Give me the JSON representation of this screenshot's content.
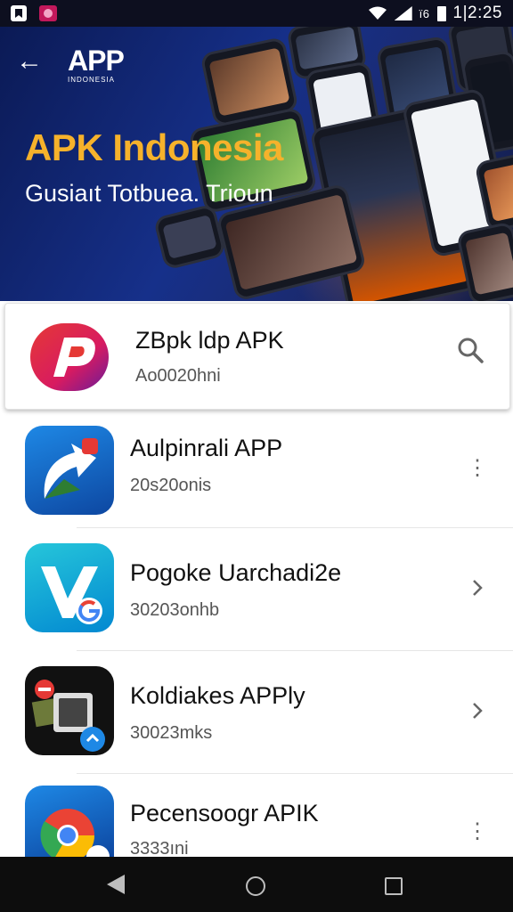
{
  "status_bar": {
    "signal_text": "ï6",
    "time": "1|2:25"
  },
  "banner": {
    "logo_text": "APP",
    "logo_subtext": "INDONESIA",
    "title": "APK Indonesia",
    "subtitle": "Gusiaıt Totbuea. Trioun"
  },
  "apps": [
    {
      "title": "ZBpk ldp APK",
      "subtitle": "Ao0020hni",
      "action": "search"
    },
    {
      "title": "Aulpinrali APP",
      "subtitle": "20s20onis",
      "action": "more"
    },
    {
      "title": "Pogoke Uarchadi2e",
      "subtitle": "30203onhb",
      "action": "chevron"
    },
    {
      "title": "Koldiakes APPly",
      "subtitle": "30023mks",
      "action": "chevron"
    },
    {
      "title": "Pecensoogr APIK",
      "subtitle": "3333ıni",
      "action": "more"
    }
  ],
  "colors": {
    "banner_bg": "#16308a",
    "banner_title": "#f6b22b",
    "accent_red": "#e53935"
  },
  "icons": {
    "back": "arrow-left-icon",
    "search": "search-icon",
    "more": "more-vertical-icon",
    "chevron": "chevron-right-icon"
  }
}
